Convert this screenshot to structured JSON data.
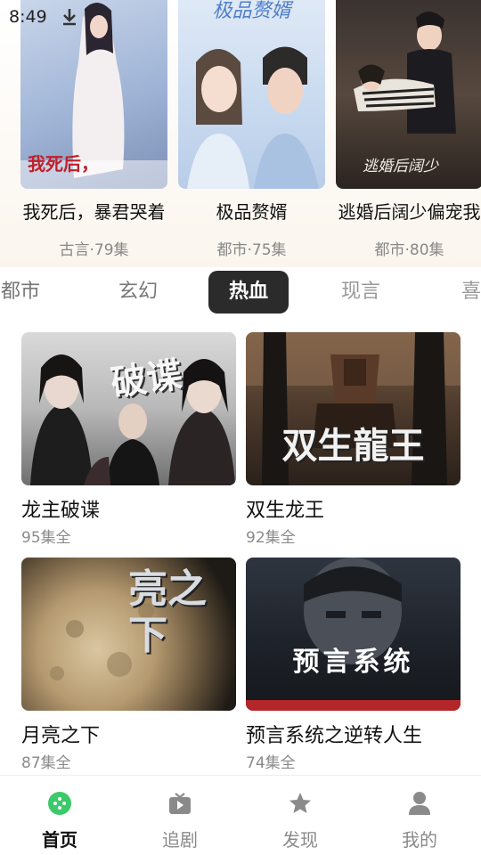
{
  "status_bar": {
    "time": "8:49"
  },
  "top_carousel": [
    {
      "title": "我死后，暴君哭着",
      "meta": "古言·79集",
      "poster_text": "我死后，"
    },
    {
      "title": "极品赘婿",
      "meta": "都市·75集",
      "poster_text": "极品赘婿"
    },
    {
      "title": "逃婚后阔少偏宠我",
      "meta": "都市·80集",
      "poster_text": "逃婚后阔少"
    }
  ],
  "tabs": [
    {
      "label": "都市"
    },
    {
      "label": "玄幻"
    },
    {
      "label": "热血"
    },
    {
      "label": "现言"
    },
    {
      "label": "喜剧"
    }
  ],
  "active_tab": "热血",
  "grid": [
    {
      "title": "龙主破谍",
      "meta": "95集全",
      "poster_text": "破谍"
    },
    {
      "title": "双生龙王",
      "meta": "92集全",
      "poster_text": "双生龍王"
    },
    {
      "title": "月亮之下",
      "meta": "87集全",
      "poster_text": "亮之下"
    },
    {
      "title": "预言系统之逆转人生",
      "meta": "74集全",
      "poster_text": "预言系统"
    }
  ],
  "bottom_nav": [
    {
      "label": "首页",
      "icon": "home-icon",
      "active": true
    },
    {
      "label": "追剧",
      "icon": "tv-icon",
      "active": false
    },
    {
      "label": "发现",
      "icon": "star-icon",
      "active": false
    },
    {
      "label": "我的",
      "icon": "user-icon",
      "active": false
    }
  ],
  "colors": {
    "active_tab_bg": "#2b2b2b",
    "home_icon": "#3cc96a"
  }
}
